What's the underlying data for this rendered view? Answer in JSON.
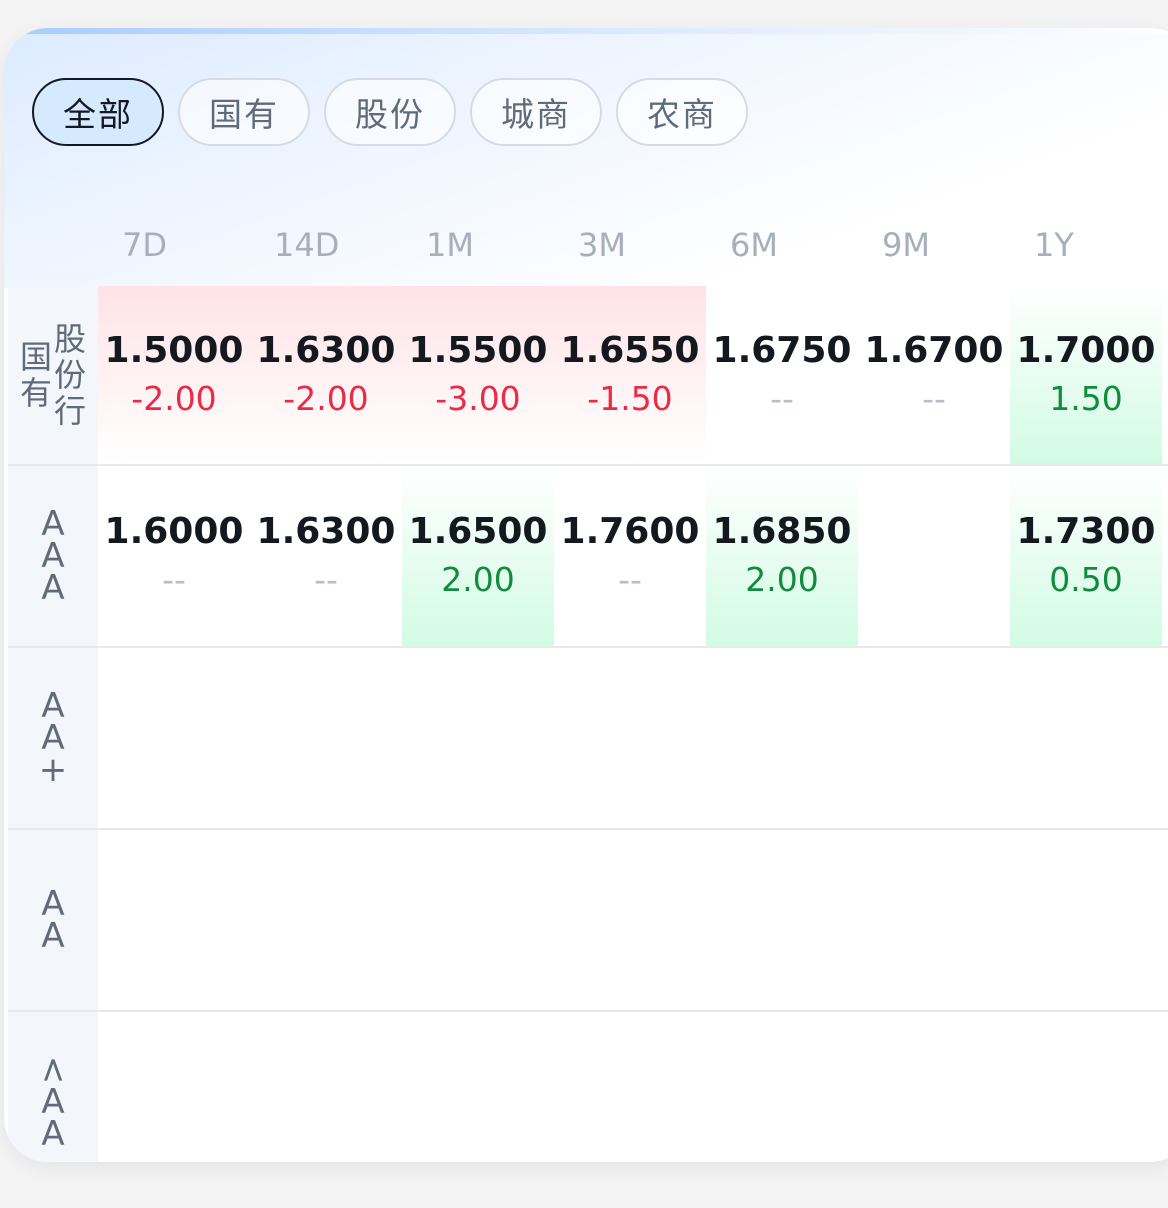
{
  "tabs": [
    "全部",
    "国有",
    "股份",
    "城商",
    "农商"
  ],
  "active_tab": "全部",
  "periods": [
    "7D",
    "14D",
    "1M",
    "3M",
    "6M",
    "9M",
    "1Y"
  ],
  "rows": [
    {
      "label_left": "国有",
      "label_right": "股份行",
      "cells": [
        {
          "rate": "1.5000",
          "change": "-2.00",
          "trend": "neg"
        },
        {
          "rate": "1.6300",
          "change": "-2.00",
          "trend": "neg"
        },
        {
          "rate": "1.5500",
          "change": "-3.00",
          "trend": "neg"
        },
        {
          "rate": "1.6550",
          "change": "-1.50",
          "trend": "neg"
        },
        {
          "rate": "1.6750",
          "change": "--",
          "trend": "none"
        },
        {
          "rate": "1.6700",
          "change": "--",
          "trend": "none"
        },
        {
          "rate": "1.7000",
          "change": "1.50",
          "trend": "pos"
        }
      ]
    },
    {
      "label": "AAA",
      "cells": [
        {
          "rate": "1.6000",
          "change": "--",
          "trend": "none"
        },
        {
          "rate": "1.6300",
          "change": "--",
          "trend": "none"
        },
        {
          "rate": "1.6500",
          "change": "2.00",
          "trend": "pos"
        },
        {
          "rate": "1.7600",
          "change": "--",
          "trend": "none"
        },
        {
          "rate": "1.6850",
          "change": "2.00",
          "trend": "pos"
        },
        {
          "rate": "",
          "change": "",
          "trend": "empty"
        },
        {
          "rate": "1.7300",
          "change": "0.50",
          "trend": "pos"
        }
      ]
    },
    {
      "label": "AA+",
      "cells": []
    },
    {
      "label": "AA",
      "cells": []
    },
    {
      "label": "<AA",
      "cells": []
    }
  ],
  "colors": {
    "negative": "#ea2b45",
    "positive": "#0f8d3b",
    "none": "#b7bec8",
    "active_tab_bg": "#d5e9ff"
  }
}
